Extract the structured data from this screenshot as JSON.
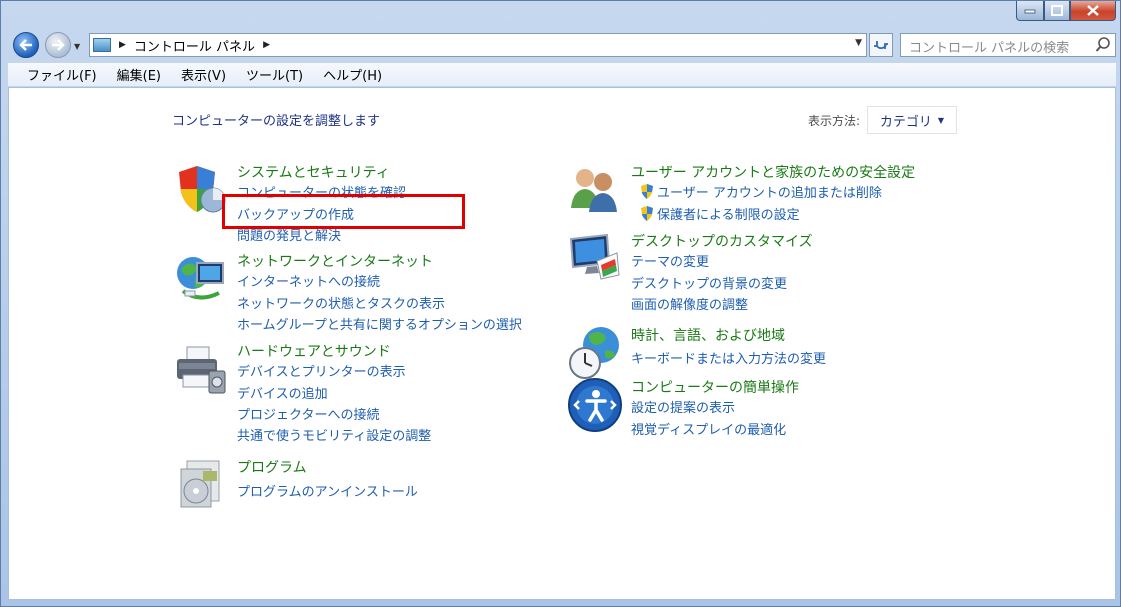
{
  "window": {
    "address_breadcrumb": "コントロール パネル",
    "search_placeholder": "コントロール パネルの検索"
  },
  "menu": [
    "ファイル(F)",
    "編集(E)",
    "表示(V)",
    "ツール(T)",
    "ヘルプ(H)"
  ],
  "content": {
    "title": "コンピューターの設定を調整します",
    "view_by_label": "表示方法:",
    "view_by_value": "カテゴリ",
    "left_categories": [
      {
        "name": "システムとセキュリティ",
        "icon": "shield-pie-icon",
        "links": [
          "コンピューターの状態を確認",
          "バックアップの作成",
          "問題の発見と解決"
        ]
      },
      {
        "name": "ネットワークとインターネット",
        "icon": "globe-network-icon",
        "links": [
          "インターネットへの接続",
          "ネットワークの状態とタスクの表示",
          "ホームグループと共有に関するオプションの選択"
        ]
      },
      {
        "name": "ハードウェアとサウンド",
        "icon": "printer-icon",
        "links": [
          "デバイスとプリンターの表示",
          "デバイスの追加",
          "プロジェクターへの接続",
          "共通で使うモビリティ設定の調整"
        ]
      },
      {
        "name": "プログラム",
        "icon": "programs-disc-icon",
        "links": [
          "プログラムのアンインストール"
        ]
      }
    ],
    "right_categories": [
      {
        "name": "ユーザー アカウントと家族のための安全設定",
        "icon": "users-icon",
        "links": [
          "ユーザー アカウントの追加または削除",
          "保護者による制限の設定"
        ]
      },
      {
        "name": "デスクトップのカスタマイズ",
        "icon": "desktop-monitor-icon",
        "links": [
          "テーマの変更",
          "デスクトップの背景の変更",
          "画面の解像度の調整"
        ]
      },
      {
        "name": "時計、言語、および地域",
        "icon": "clock-globe-icon",
        "links": [
          "キーボードまたは入力方法の変更"
        ]
      },
      {
        "name": "コンピューターの簡単操作",
        "icon": "ease-of-access-icon",
        "links": [
          "設定の提案の表示",
          "視覚ディスプレイの最適化"
        ]
      }
    ]
  }
}
